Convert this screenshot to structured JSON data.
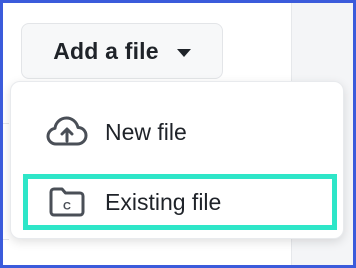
{
  "add_button": {
    "label": "Add a file"
  },
  "menu": {
    "items": [
      {
        "label": "New file",
        "icon": "cloud-upload-icon"
      },
      {
        "label": "Existing file",
        "icon": "folder-icon",
        "folder_badge": "C"
      }
    ]
  },
  "colors": {
    "highlight": "#2ee6c8",
    "frame_border": "#3b5bdb",
    "text": "#1f2329",
    "icon": "#4a4f57"
  }
}
